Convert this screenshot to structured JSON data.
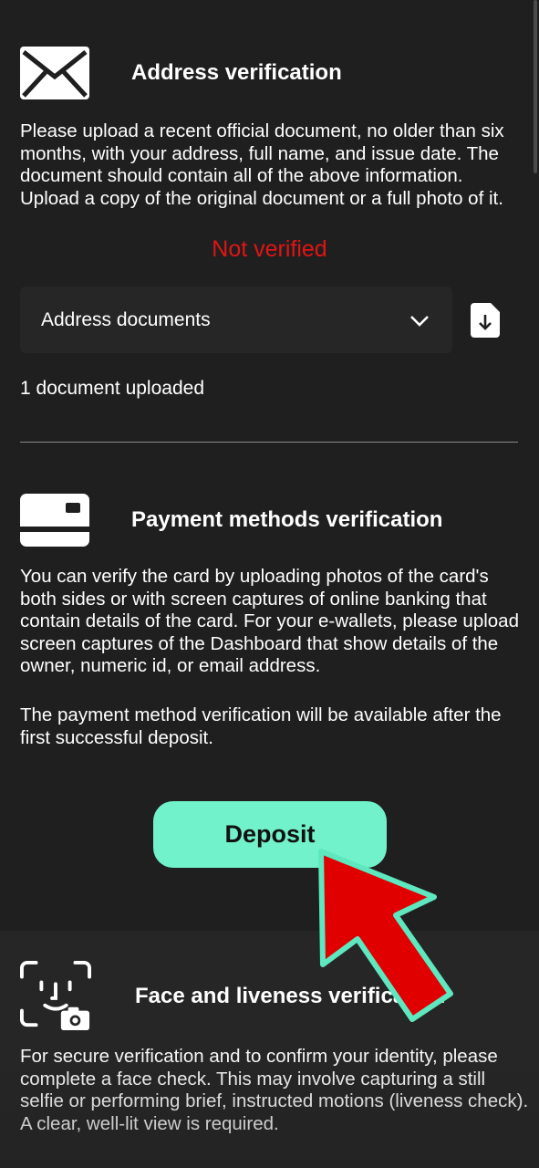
{
  "address": {
    "title": "Address verification",
    "description": "Please upload a recent official document, no older than six months, with your address, full name, and issue date. The document should contain all of the above information. Upload a copy of the original document or a full photo of it.",
    "status": "Not verified",
    "status_color": "#e01515",
    "select_value": "Address documents",
    "uploaded_text": "1 document uploaded",
    "icons": {
      "section": "envelope-icon",
      "dropdown": "chevron-down-icon",
      "upload": "file-download-icon"
    }
  },
  "payment": {
    "title": "Payment methods verification",
    "description": "You can verify the card by uploading photos of the card's both sides or with screen captures of online banking that contain details of the card. For your e-wallets, please upload screen captures of the Dashboard that show details of the owner, numeric id, or email address.",
    "note": "The payment method verification will be available after the first successful deposit.",
    "deposit_label": "Deposit",
    "accent_color": "#72f2ca",
    "icons": {
      "section": "credit-card-icon"
    }
  },
  "face": {
    "title": "Face and liveness verification",
    "description": "For secure verification and to confirm your identity, please complete a face check. This may involve capturing a still selfie or performing brief, instructed motions (liveness check). A clear, well-lit view is required.",
    "icons": {
      "section": "face-scan-icon"
    }
  },
  "overlay": {
    "icon": "red-pointer-arrow-icon",
    "color": "#e00000"
  }
}
